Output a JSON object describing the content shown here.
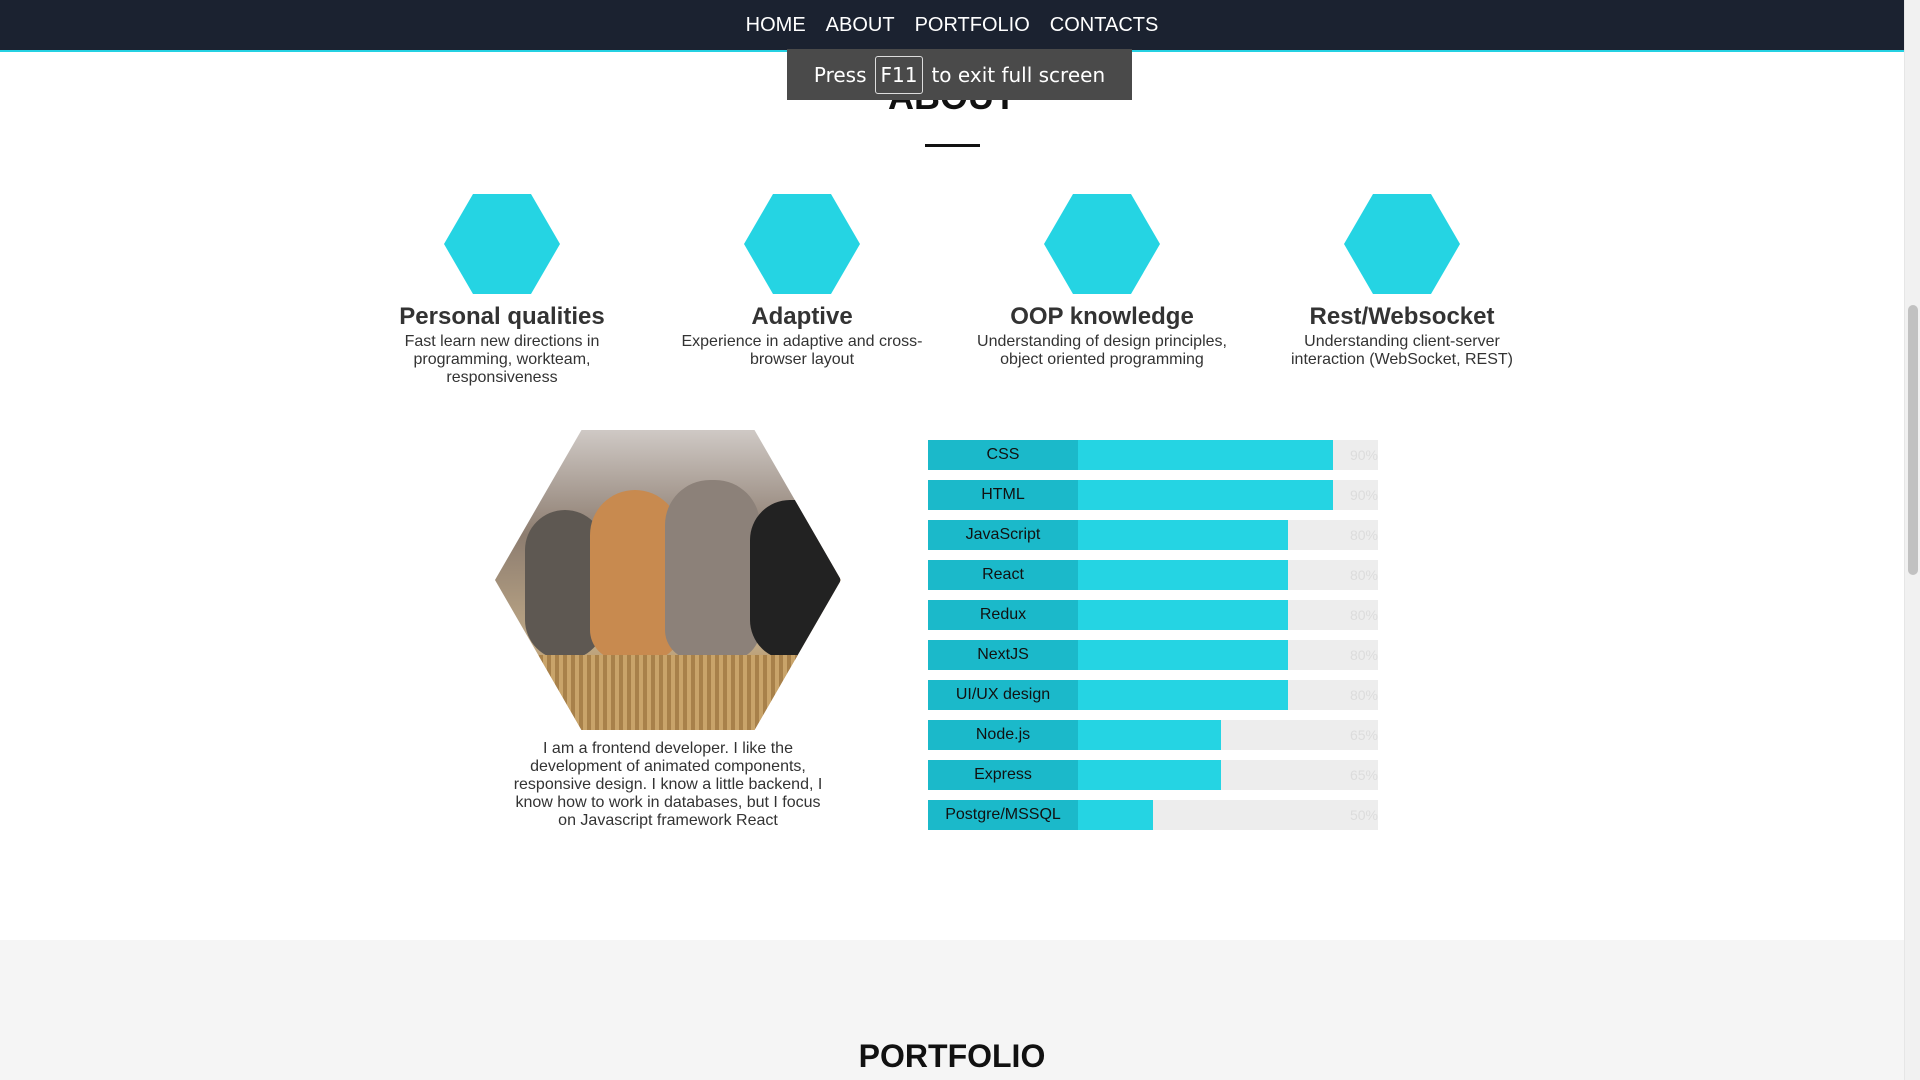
{
  "nav": {
    "items": [
      "HOME",
      "ABOUT",
      "PORTFOLIO",
      "CONTACTS"
    ]
  },
  "toast": {
    "before": "Press",
    "key": "F11",
    "after": "to exit full screen"
  },
  "about": {
    "title": "ABOUT",
    "features": [
      {
        "title": "Personal qualities",
        "text": "Fast learn new directions in programming, workteam, responsiveness"
      },
      {
        "title": "Adaptive",
        "text": "Experience in adaptive and cross-browser layout"
      },
      {
        "title": "OOP knowledge",
        "text": "Understanding of design principles, object oriented programming"
      },
      {
        "title": "Rest/Websocket",
        "text": "Understanding client-server interaction (WebSocket, REST)"
      }
    ],
    "bio": "I am a frontend developer. I like the development of animated components, responsive design. I know a little backend, I know how to work in databases, but I focus on Javascript framework React",
    "skills": [
      {
        "label": "CSS",
        "percent": 90,
        "percent_text": "90%"
      },
      {
        "label": "HTML",
        "percent": 90,
        "percent_text": "90%"
      },
      {
        "label": "JavaScript",
        "percent": 80,
        "percent_text": "80%"
      },
      {
        "label": "React",
        "percent": 80,
        "percent_text": "80%"
      },
      {
        "label": "Redux",
        "percent": 80,
        "percent_text": "80%"
      },
      {
        "label": "NextJS",
        "percent": 80,
        "percent_text": "80%"
      },
      {
        "label": "UI/UX design",
        "percent": 80,
        "percent_text": "80%"
      },
      {
        "label": "Node.js",
        "percent": 65,
        "percent_text": "65%"
      },
      {
        "label": "Express",
        "percent": 65,
        "percent_text": "65%"
      },
      {
        "label": "Postgre/MSSQL",
        "percent": 50,
        "percent_text": "50%"
      }
    ]
  },
  "portfolio": {
    "title": "PORTFOLIO"
  },
  "colors": {
    "accent": "#25d4e3",
    "accent_dark": "#1bb9ca",
    "nav_bg": "#1b2230"
  }
}
